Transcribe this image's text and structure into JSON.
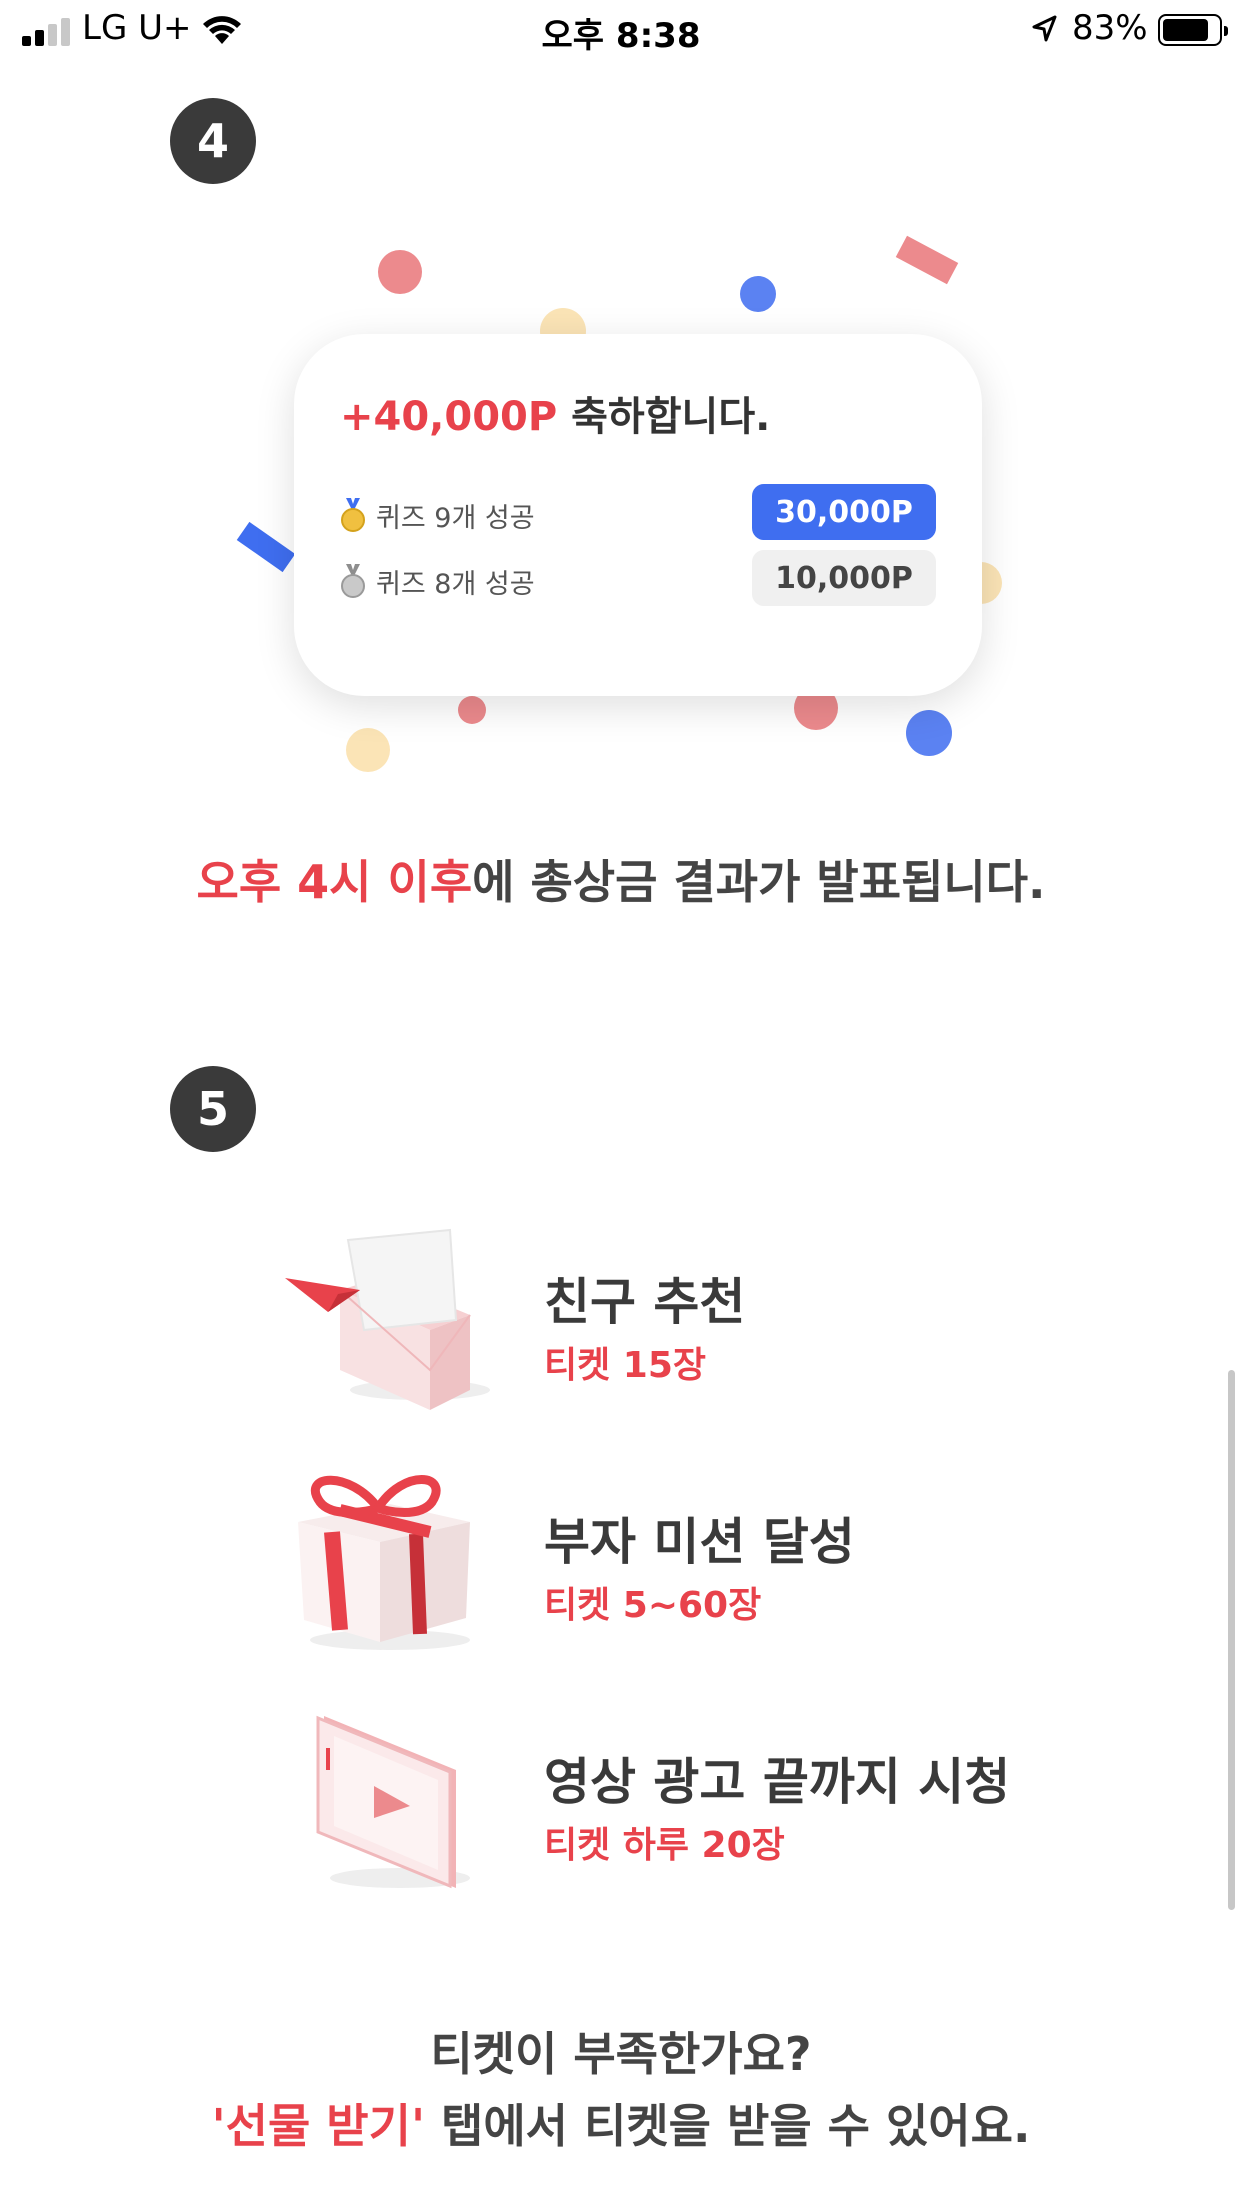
{
  "status_bar": {
    "carrier": "LG U+",
    "time": "오후 8:38",
    "battery_percent": "83%",
    "battery_level": 0.83,
    "signal_bars_filled": 2,
    "signal_bars_total": 4
  },
  "step4": {
    "badge": "4",
    "card": {
      "title_points": "+40,000P",
      "title_text": " 축하합니다.",
      "rows": [
        {
          "medal_icon": "gold-medal-icon",
          "label": "퀴즈 9개 성공",
          "points": "30,000P",
          "style": "primary"
        },
        {
          "medal_icon": "silver-medal-icon",
          "label": "퀴즈 8개 성공",
          "points": "10,000P",
          "style": "secondary"
        }
      ]
    },
    "announcement_highlight": "오후 4시 이후",
    "announcement_rest": "에 총상금 결과가 발표됩니다."
  },
  "step5": {
    "badge": "5",
    "items": [
      {
        "icon": "envelope-paper-plane-icon",
        "title": "친구 추천",
        "subtitle": "티켓 15장"
      },
      {
        "icon": "gift-box-icon",
        "title": "부자 미션 달성",
        "subtitle": "티켓 5~60장"
      },
      {
        "icon": "video-phone-icon",
        "title": "영상 광고 끝까지 시청",
        "subtitle": "티켓 하루 20장"
      }
    ]
  },
  "footer": {
    "line1": "티켓이 부족한가요?",
    "highlight": "'선물 받기'",
    "rest": " 탭에서 티켓을 받을 수 있어요."
  },
  "colors": {
    "accent_red": "#e8424b",
    "accent_blue": "#3f6ef0",
    "badge_dark": "#3a3a3a",
    "confetti_red": "#ec8a8d",
    "confetti_blue": "#5b82f2",
    "confetti_yellow": "#fbe4b6"
  }
}
